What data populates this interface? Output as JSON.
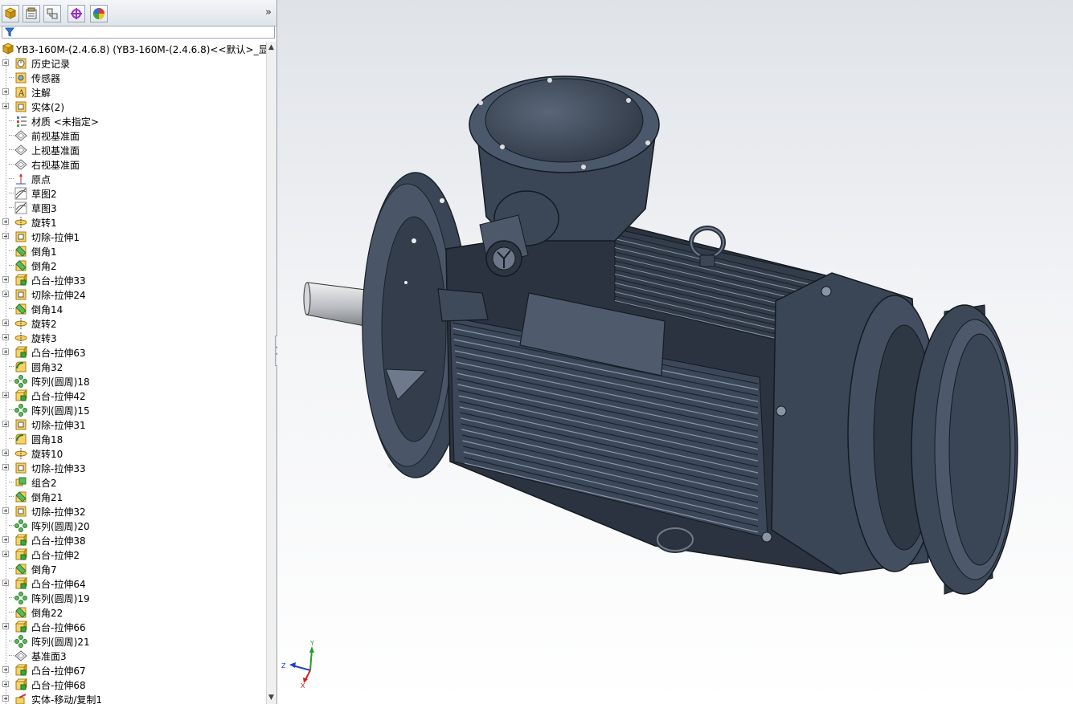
{
  "panel": {
    "more_label": "»",
    "root_label": "YB3-160M-(2.4.6.8)  (YB3-160M-(2.4.6.8)<<默认>_显示",
    "tree": [
      {
        "label": "历史记录",
        "icon": "history-icon",
        "expand": true
      },
      {
        "label": "传感器",
        "icon": "sensor-icon",
        "expand": false
      },
      {
        "label": "注解",
        "icon": "annotation-icon",
        "expand": true
      },
      {
        "label": "实体(2)",
        "icon": "solid-bodies-icon",
        "expand": true
      },
      {
        "label": "材质 <未指定>",
        "icon": "material-icon",
        "expand": false
      },
      {
        "label": "前视基准面",
        "icon": "plane-icon",
        "expand": false
      },
      {
        "label": "上视基准面",
        "icon": "plane-icon",
        "expand": false
      },
      {
        "label": "右视基准面",
        "icon": "plane-icon",
        "expand": false
      },
      {
        "label": "原点",
        "icon": "origin-icon",
        "expand": false
      },
      {
        "label": "草图2",
        "icon": "sketch-icon",
        "expand": false
      },
      {
        "label": "草图3",
        "icon": "sketch-icon",
        "expand": false
      },
      {
        "label": "旋转1",
        "icon": "revolve-icon",
        "expand": true
      },
      {
        "label": "切除-拉伸1",
        "icon": "cut-extrude-icon",
        "expand": true
      },
      {
        "label": "倒角1",
        "icon": "chamfer-icon",
        "expand": false
      },
      {
        "label": "倒角2",
        "icon": "chamfer-icon",
        "expand": false
      },
      {
        "label": "凸台-拉伸33",
        "icon": "boss-extrude-icon",
        "expand": true
      },
      {
        "label": "切除-拉伸24",
        "icon": "cut-extrude-icon",
        "expand": true
      },
      {
        "label": "倒角14",
        "icon": "chamfer-icon",
        "expand": false
      },
      {
        "label": "旋转2",
        "icon": "revolve-icon",
        "expand": true
      },
      {
        "label": "旋转3",
        "icon": "revolve-icon",
        "expand": true
      },
      {
        "label": "凸台-拉伸63",
        "icon": "boss-extrude-icon",
        "expand": true
      },
      {
        "label": "圆角32",
        "icon": "fillet-icon",
        "expand": false
      },
      {
        "label": "阵列(圆周)18",
        "icon": "circular-pattern-icon",
        "expand": false
      },
      {
        "label": "凸台-拉伸42",
        "icon": "boss-extrude-icon",
        "expand": true
      },
      {
        "label": "阵列(圆周)15",
        "icon": "circular-pattern-icon",
        "expand": false
      },
      {
        "label": "切除-拉伸31",
        "icon": "cut-extrude-icon",
        "expand": true
      },
      {
        "label": "圆角18",
        "icon": "fillet-icon",
        "expand": false
      },
      {
        "label": "旋转10",
        "icon": "revolve-icon",
        "expand": true
      },
      {
        "label": "切除-拉伸33",
        "icon": "cut-extrude-icon",
        "expand": true
      },
      {
        "label": "组合2",
        "icon": "combine-icon",
        "expand": false
      },
      {
        "label": "倒角21",
        "icon": "chamfer-icon",
        "expand": false
      },
      {
        "label": "切除-拉伸32",
        "icon": "cut-extrude-icon",
        "expand": true
      },
      {
        "label": "阵列(圆周)20",
        "icon": "circular-pattern-icon",
        "expand": false
      },
      {
        "label": "凸台-拉伸38",
        "icon": "boss-extrude-icon",
        "expand": true
      },
      {
        "label": "凸台-拉伸2",
        "icon": "boss-extrude-icon",
        "expand": true
      },
      {
        "label": "倒角7",
        "icon": "chamfer-icon",
        "expand": false
      },
      {
        "label": "凸台-拉伸64",
        "icon": "boss-extrude-icon",
        "expand": true
      },
      {
        "label": "阵列(圆周)19",
        "icon": "circular-pattern-icon",
        "expand": false
      },
      {
        "label": "倒角22",
        "icon": "chamfer-icon",
        "expand": false
      },
      {
        "label": "凸台-拉伸66",
        "icon": "boss-extrude-icon",
        "expand": true
      },
      {
        "label": "阵列(圆周)21",
        "icon": "circular-pattern-icon",
        "expand": false
      },
      {
        "label": "基准面3",
        "icon": "plane-icon",
        "expand": false
      },
      {
        "label": "凸台-拉伸67",
        "icon": "boss-extrude-icon",
        "expand": true
      },
      {
        "label": "凸台-拉伸68",
        "icon": "boss-extrude-icon",
        "expand": true
      },
      {
        "label": "实体-移动/复制1",
        "icon": "move-copy-icon",
        "expand": true
      }
    ]
  },
  "triad": {
    "x_label": "X",
    "y_label": "Y",
    "z_label": "Z"
  },
  "colors": {
    "model_body": "#3b4656",
    "model_dark": "#262e39",
    "model_light": "#6b7688",
    "axis_x": "#d12020",
    "axis_y": "#2a9a2a",
    "axis_z": "#2040c8"
  }
}
